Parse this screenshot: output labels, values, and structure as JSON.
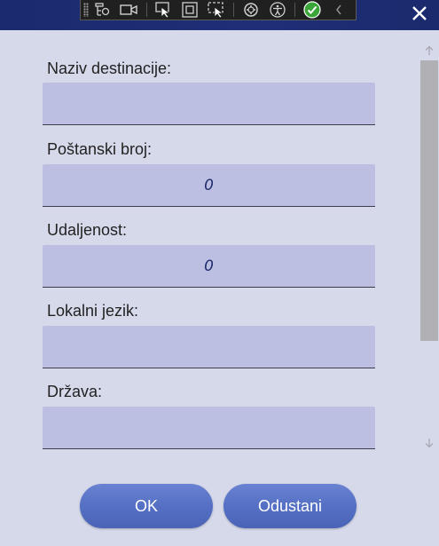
{
  "toolbar": {
    "icons": [
      "live-visual-tree-icon",
      "record-icon",
      "select-element-icon",
      "display-layout-adorners-icon",
      "track-focused-element-icon",
      "binding-failures-icon",
      "accessibility-icon",
      "no-errors-check-icon",
      "collapse-chevron-icon"
    ]
  },
  "window": {
    "close_glyph": "✕"
  },
  "form": {
    "fields": [
      {
        "label": "Naziv destinacije:",
        "value": ""
      },
      {
        "label": "Poštanski broj:",
        "value": "0"
      },
      {
        "label": "Udaljenost:",
        "value": "0"
      },
      {
        "label": "Lokalni jezik:",
        "value": ""
      },
      {
        "label": "Država:",
        "value": ""
      }
    ]
  },
  "buttons": {
    "ok": "OK",
    "cancel": "Odustani"
  },
  "colors": {
    "title_bar": "#1e2f78",
    "field_bg": "#bdbfe2",
    "button": "#5570c4",
    "check": "#3aa63a"
  }
}
